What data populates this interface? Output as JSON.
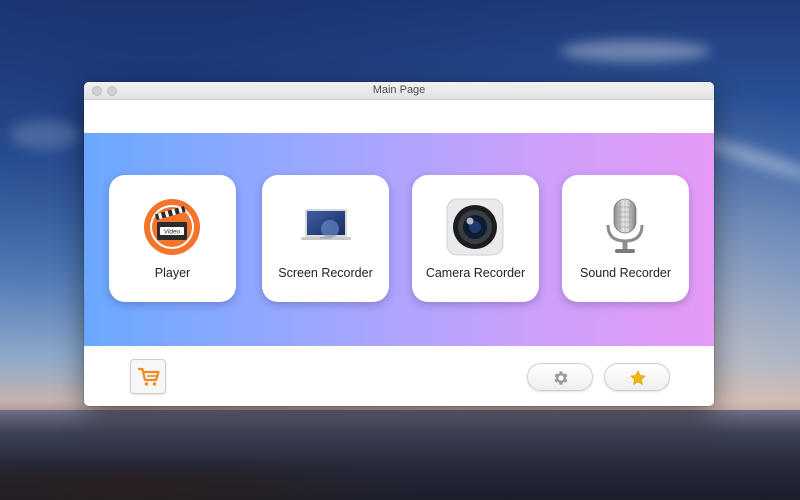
{
  "window": {
    "title": "Main Page"
  },
  "features": [
    {
      "label": "Player",
      "icon": "video-clapperboard-icon"
    },
    {
      "label": "Screen Recorder",
      "icon": "laptop-icon"
    },
    {
      "label": "Camera Recorder",
      "icon": "camera-lens-icon"
    },
    {
      "label": "Sound Recorder",
      "icon": "microphone-icon"
    }
  ],
  "player_icon_text": "Video",
  "footer": {
    "cart_icon": "shopping-cart-icon",
    "settings_icon": "gear-icon",
    "rate_icon": "star-icon"
  },
  "colors": {
    "hero_gradient_start": "#6aa8ff",
    "hero_gradient_end": "#e59af6",
    "cart_orange": "#f08a1c",
    "star_gold": "#f2b705"
  }
}
